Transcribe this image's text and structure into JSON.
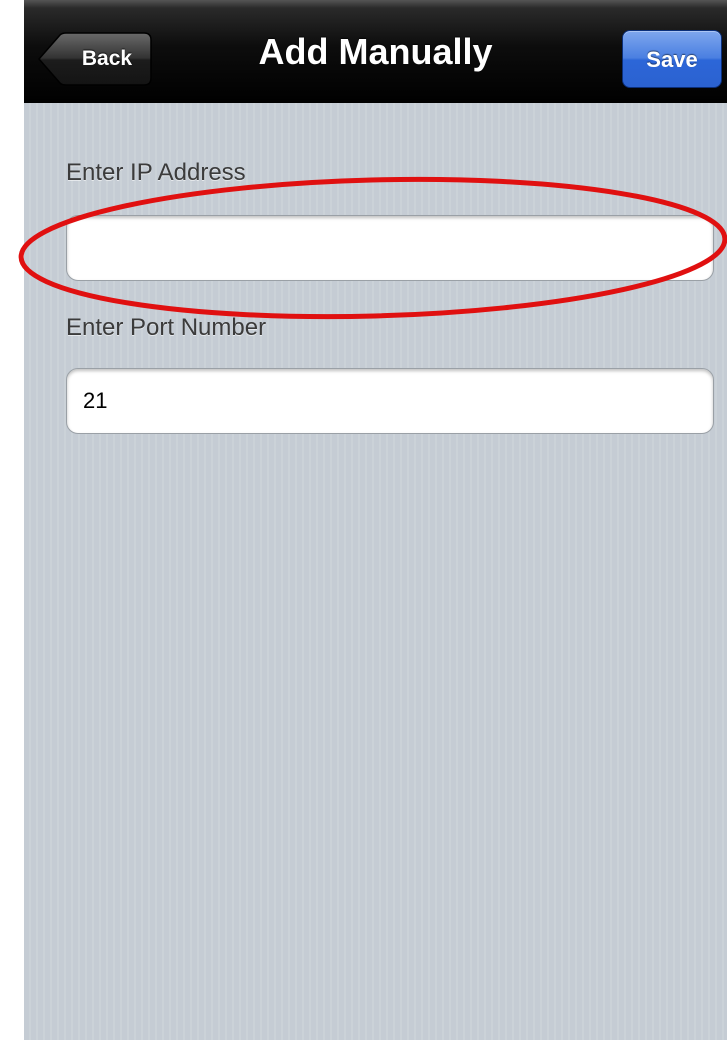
{
  "navbar": {
    "title": "Add Manually",
    "back_label": "Back",
    "save_label": "Save"
  },
  "form": {
    "ip": {
      "label": "Enter IP Address",
      "value": ""
    },
    "port": {
      "label": "Enter Port Number",
      "value": "21"
    }
  },
  "colors": {
    "navbar": "#000000",
    "save_button": "#3b72dc",
    "background": "#c5ccd4",
    "annotation": "#e01010"
  }
}
